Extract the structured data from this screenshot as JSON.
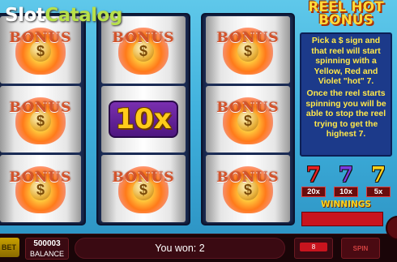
{
  "watermark": {
    "part1": "Slot",
    "part2": "Catalog"
  },
  "game_logo": {
    "line1": "REEL HOT",
    "line2": "BONUS"
  },
  "reels": [
    [
      "BONUS",
      "BONUS",
      "BONUS"
    ],
    [
      "BONUS",
      "10x",
      "BONUS"
    ],
    [
      "BONUS",
      "BONUS",
      "BONUS"
    ]
  ],
  "symbols": {
    "bonus_label": "BONUS",
    "dollar": "$",
    "multiplier": "10x"
  },
  "info": {
    "paragraph1": "Pick a $ sign and that reel will start spinning with a Yellow, Red and Violet \"hot\" 7.",
    "paragraph2": "Once the reel starts spinning you will be able to stop the reel trying to get the highest 7."
  },
  "sevens": [
    {
      "glyph": "7",
      "color": "red",
      "multiplier": "20x"
    },
    {
      "glyph": "7",
      "color": "violet",
      "multiplier": "10x"
    },
    {
      "glyph": "7",
      "color": "yellow",
      "multiplier": "5x"
    }
  ],
  "winnings": {
    "label": "WINNINGS",
    "value": ""
  },
  "bottom_bar": {
    "bet_label": "BET",
    "balance_value": "500003",
    "balance_label": "BALANCE",
    "message": "You won: 2",
    "lines_value": "8",
    "spin_label": "SPIN"
  },
  "colors": {
    "background": "#3fb0dc",
    "panel": "#1c3a8a",
    "info_text": "#ffe84a",
    "bottom_bar": "#1a0508",
    "winnings_box": "#c8141e"
  }
}
